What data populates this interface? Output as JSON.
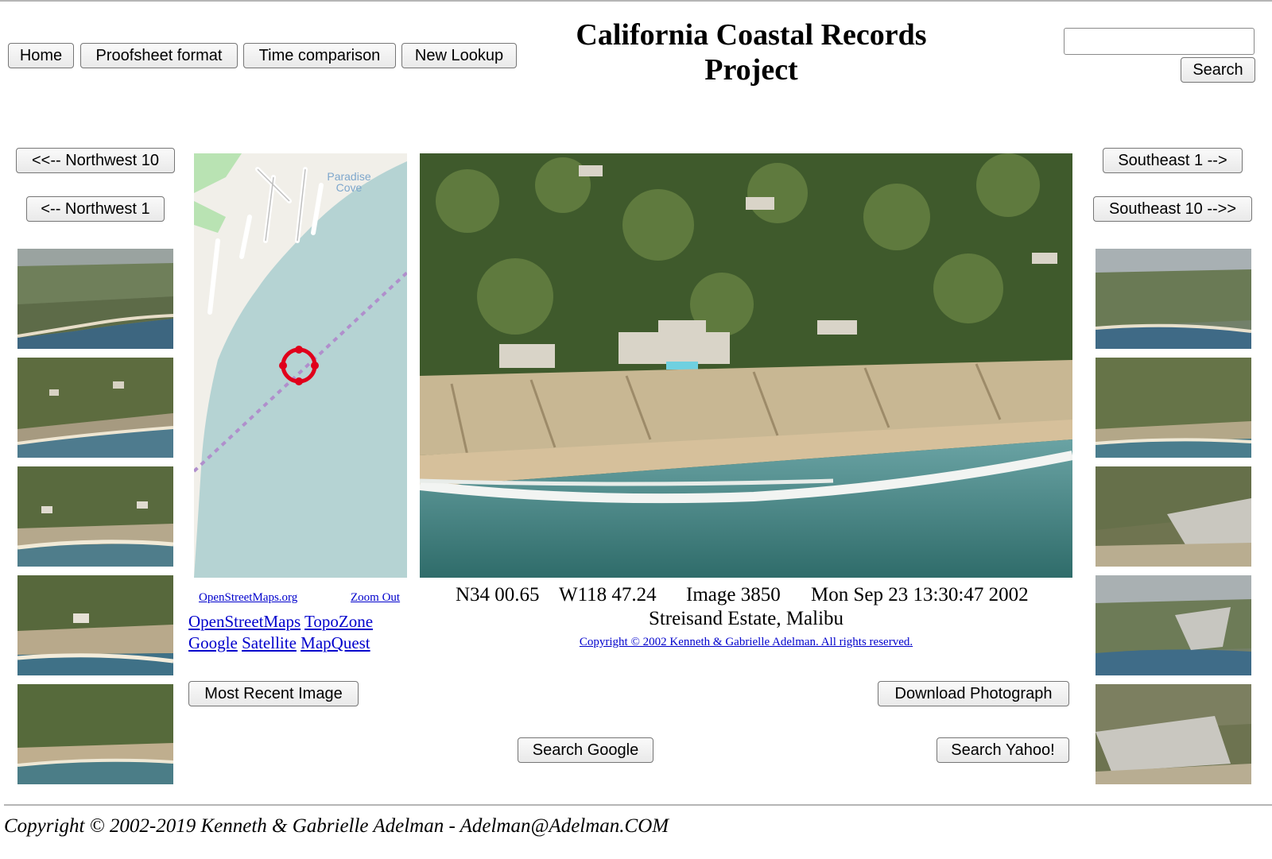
{
  "nav": {
    "home": "Home",
    "proofsheet": "Proofsheet format",
    "time_comparison": "Time comparison",
    "new_lookup": "New Lookup"
  },
  "title": {
    "line1": "California Coastal Records",
    "line2": "Project"
  },
  "search": {
    "value": "",
    "button": "Search"
  },
  "left_nav": {
    "northwest10": "<<-- Northwest 10",
    "northwest1": "<-- Northwest 1"
  },
  "right_nav": {
    "southeast1": "Southeast 1 -->",
    "southeast10": "Southeast 10 -->>"
  },
  "map": {
    "place_label": "Paradise Cove",
    "osm_link": "OpenStreetMaps.org",
    "zoom_out": "Zoom Out",
    "links_row1": [
      "OpenStreetMaps",
      "TopoZone"
    ],
    "links_row2": [
      "Google",
      "Satellite",
      "MapQuest"
    ]
  },
  "photo": {
    "lat": "N34 00.65",
    "lon": "W118 47.24",
    "image_number": "Image 3850",
    "datetime": "Mon Sep 23 13:30:47 2002",
    "caption": "Streisand Estate, Malibu",
    "copyright": "Copyright © 2002 Kenneth & Gabrielle Adelman. All rights reserved."
  },
  "actions": {
    "most_recent": "Most Recent Image",
    "download": "Download Photograph",
    "search_google": "Search Google",
    "search_yahoo": "Search Yahoo!"
  },
  "footer": {
    "text": "Copyright © 2002-2019 Kenneth & Gabrielle Adelman - Adelman@Adelman.COM"
  },
  "colors": {
    "sea": "#b5d3d3",
    "land": "#f1efe9",
    "park": "#b9e3b3",
    "track": "#b08fcc",
    "marker": "#e0001b",
    "link": "#0000cc"
  }
}
